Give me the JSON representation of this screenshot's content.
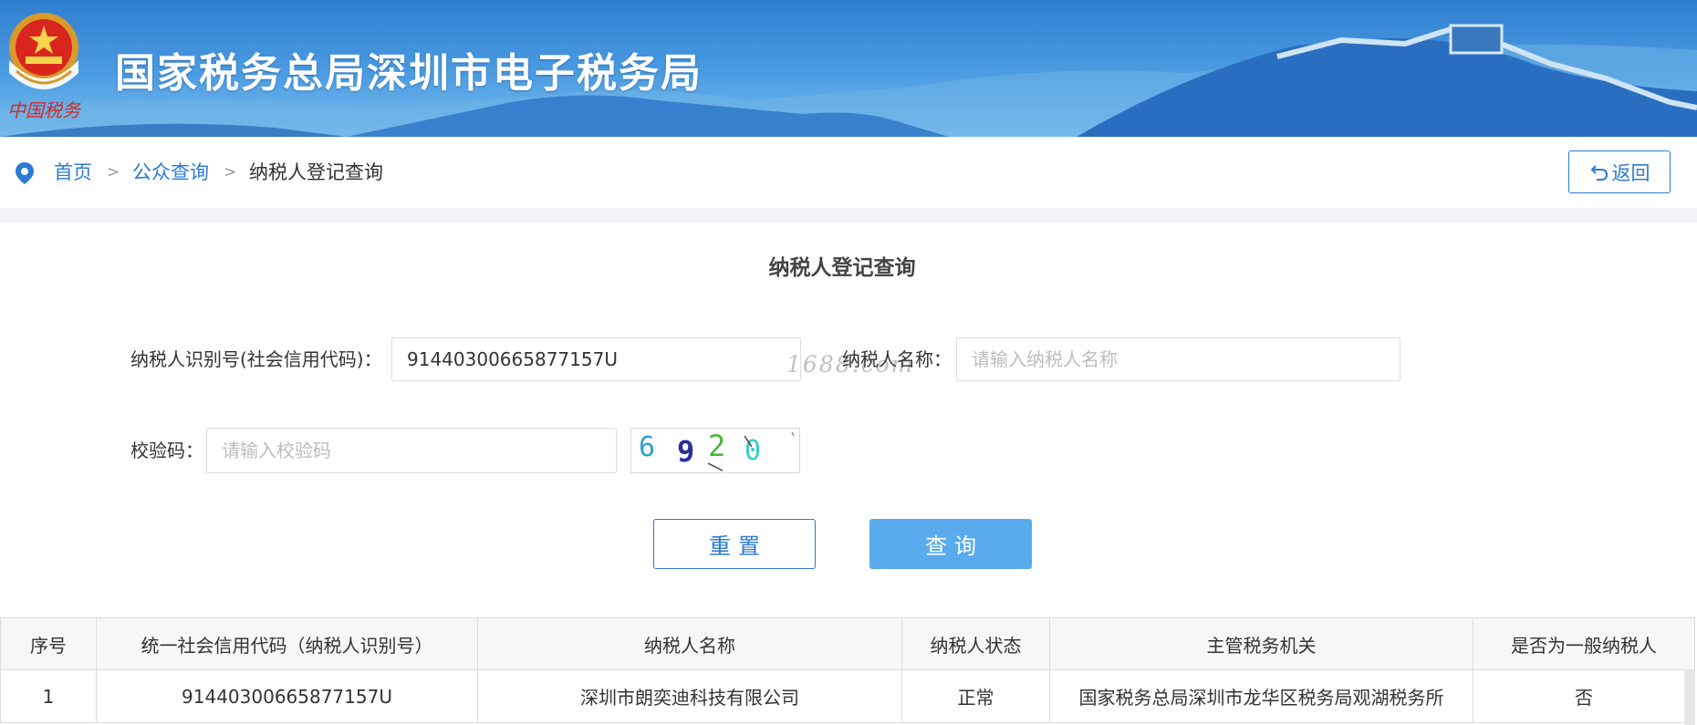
{
  "header": {
    "site_title": "国家税务总局深圳市电子税务局",
    "emblem_text": "中国税务"
  },
  "breadcrumb": {
    "items": [
      {
        "label": "首页",
        "link": true
      },
      {
        "label": "公众查询",
        "link": true
      },
      {
        "label": "纳税人登记查询",
        "link": false
      }
    ],
    "separator": ">",
    "back_label": "返回"
  },
  "form": {
    "title": "纳税人登记查询",
    "taxpayer_id_label": "纳税人识别号(社会信用代码)：",
    "taxpayer_id_value": "91440300665877157U",
    "taxpayer_name_label": "纳税人名称：",
    "taxpayer_name_placeholder": "请输入纳税人名称",
    "captcha_label": "校验码：",
    "captcha_placeholder": "请输入校验码",
    "captcha_chars": [
      "6",
      "9",
      "2",
      "0"
    ],
    "watermark": "1688.com",
    "reset_label": "重置",
    "query_label": "查询"
  },
  "results": {
    "columns": [
      "序号",
      "统一社会信用代码（纳税人识别号）",
      "纳税人名称",
      "纳税人状态",
      "主管税务机关",
      "是否为一般纳税人"
    ],
    "rows": [
      [
        "1",
        "91440300665877157U",
        "深圳市朗奕迪科技有限公司",
        "正常",
        "国家税务总局深圳市龙华区税务局观湖税务所",
        "否"
      ]
    ]
  },
  "colors": {
    "primary": "#2b7bd3",
    "query_button": "#5aabee",
    "banner_top": "#2f7fd0",
    "border": "#dcdcdc"
  },
  "icons": [
    "emblem-icon",
    "location-pin-icon",
    "return-arrow-icon"
  ]
}
